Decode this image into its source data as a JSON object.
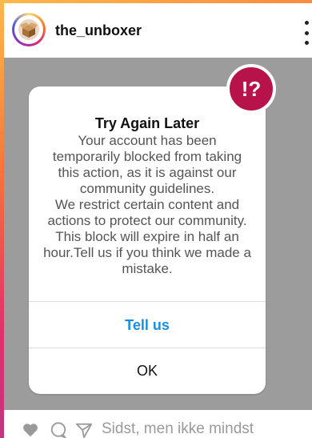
{
  "post": {
    "username": "the_unboxer",
    "avatar_icon": "unboxing-box-icon",
    "more_icon": "more-options-icon"
  },
  "dialog": {
    "badge": "!?",
    "title": "Try Again Later",
    "body_1": "Your account has been temporarily blocked from taking this action, as it is against our community guidelines.",
    "body_2": "We restrict certain content and actions to protect our community. This block will expire in half an hour.Tell us if you think we made a mistake.",
    "tell_us": "Tell us",
    "ok": "OK",
    "accent_color": "#1a8fe0",
    "badge_color": "#b8124b"
  },
  "footer": {
    "caption": "Sidst, men ikke mindst",
    "icons": [
      "heart-icon",
      "comment-icon",
      "share-icon"
    ]
  }
}
